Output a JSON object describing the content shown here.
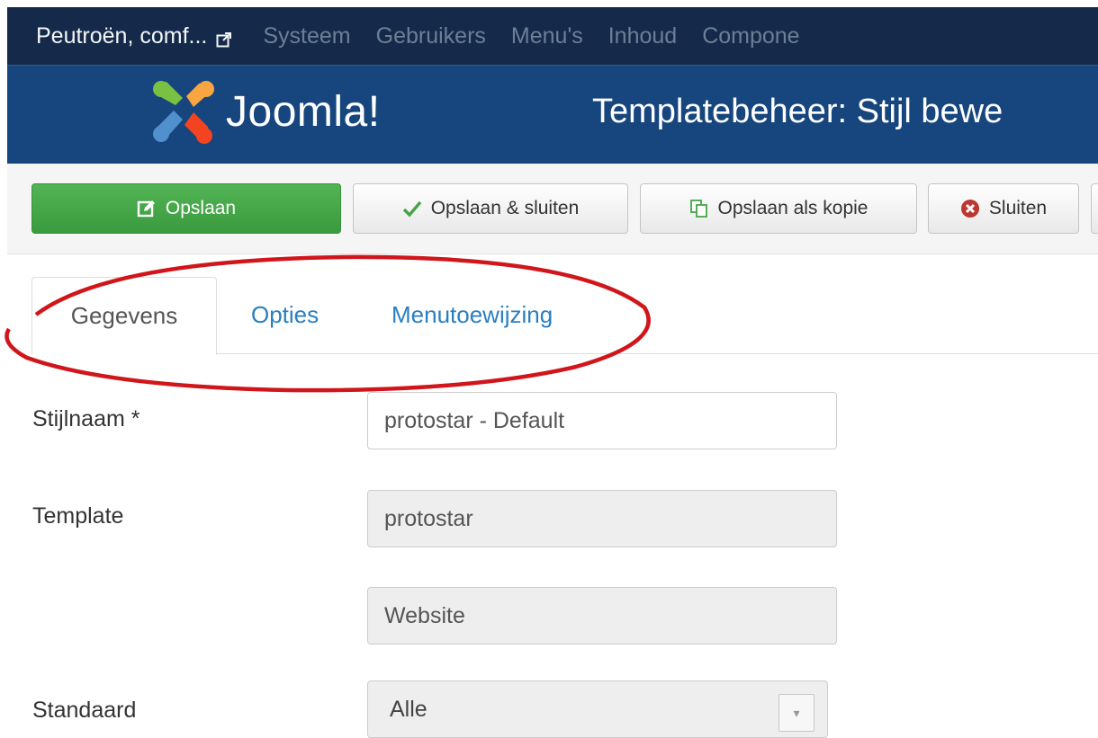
{
  "topnav": {
    "site_name": "Peutroën, comf...",
    "items": [
      "Systeem",
      "Gebruikers",
      "Menu's",
      "Inhoud",
      "Compone"
    ]
  },
  "header": {
    "logo_text": "Joomla!",
    "page_title": "Templatebeheer: Stijl bewe"
  },
  "toolbar": {
    "save": "Opslaan",
    "save_close": "Opslaan & sluiten",
    "save_copy": "Opslaan als kopie",
    "close": "Sluiten"
  },
  "tabs": [
    "Gegevens",
    "Opties",
    "Menutoewijzing"
  ],
  "form": {
    "style_name_label": "Stijlnaam *",
    "style_name_value": "protostar - Default",
    "template_label": "Template",
    "template_value": "protostar",
    "client_value": "Website",
    "default_label": "Standaard",
    "default_value": "Alle"
  },
  "colors": {
    "topnav_bg": "#152a4a",
    "header_bg": "#17467f",
    "save_button": "#46a94a",
    "tab_link": "#2a7fc0",
    "highlight_ellipse": "#d0161b"
  },
  "icons": {
    "external_link": "external-link-icon",
    "save": "edit-icon",
    "save_close": "checkmark-icon",
    "save_copy": "copy-icon",
    "close": "cancel-circle-icon",
    "select": "chevron-down-icon"
  }
}
